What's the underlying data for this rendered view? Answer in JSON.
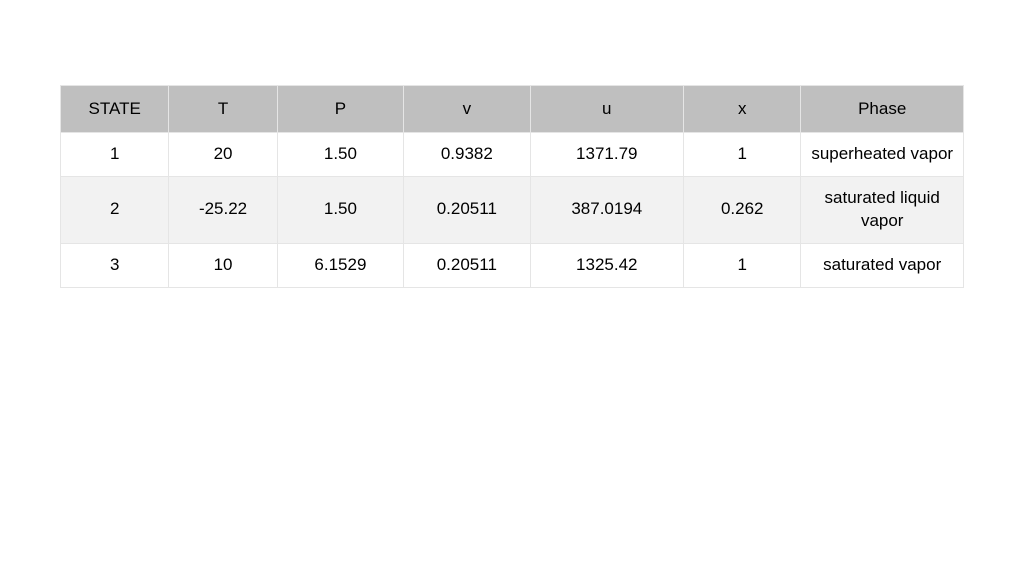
{
  "chart_data": {
    "type": "table",
    "columns": [
      "STATE",
      "T",
      "P",
      "v",
      "u",
      "x",
      "Phase"
    ],
    "rows": [
      [
        "1",
        "20",
        "1.50",
        "0.9382",
        "1371.79",
        "1",
        "superheated vapor"
      ],
      [
        "2",
        "-25.22",
        "1.50",
        "0.20511",
        "387.0194",
        "0.262",
        "saturated liquid vapor"
      ],
      [
        "3",
        "10",
        "6.1529",
        "0.20511",
        "1325.42",
        "1",
        "saturated vapor"
      ]
    ]
  }
}
